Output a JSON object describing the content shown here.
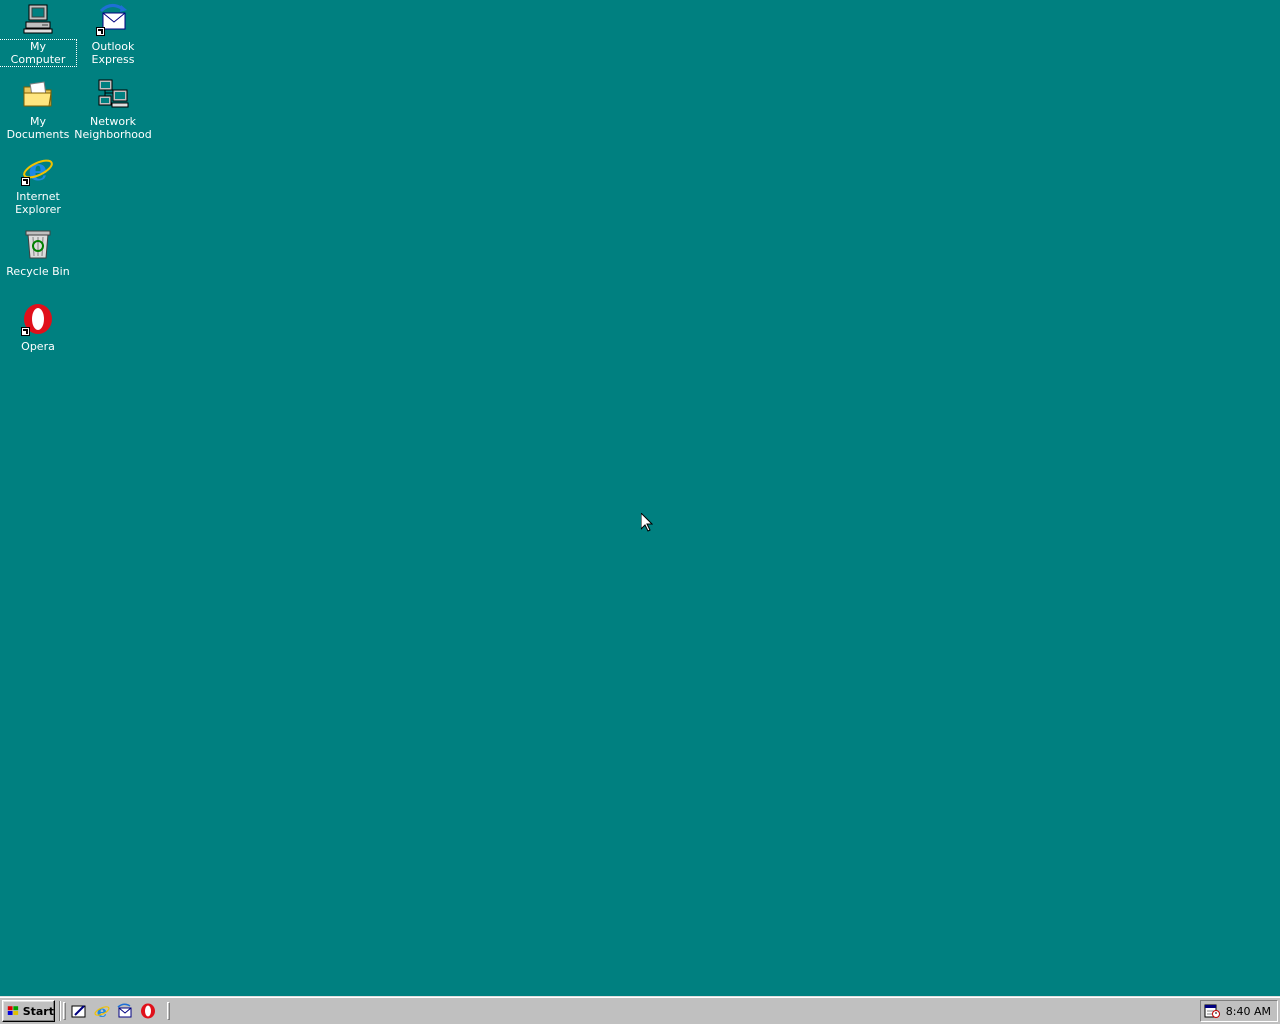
{
  "desktop": {
    "background_color": "#008080",
    "icons": [
      {
        "label": "My Computer",
        "icon": "my-computer-icon",
        "selected": true
      },
      {
        "label": "Outlook\nExpress",
        "icon": "outlook-express-icon",
        "shortcut": true
      },
      {
        "label": "My Documents",
        "icon": "my-documents-icon"
      },
      {
        "label": "Network\nNeighborhood",
        "icon": "network-neighborhood-icon"
      },
      {
        "label": "Internet\nExplorer",
        "icon": "internet-explorer-icon",
        "shortcut": true
      },
      {
        "label": "Recycle Bin",
        "icon": "recycle-bin-icon"
      },
      {
        "label": "Opera",
        "icon": "opera-icon",
        "shortcut": true
      }
    ]
  },
  "taskbar": {
    "start_label": "Start",
    "quick_launch": [
      {
        "icon": "show-desktop-icon"
      },
      {
        "icon": "internet-explorer-icon"
      },
      {
        "icon": "outlook-express-icon"
      },
      {
        "icon": "opera-icon"
      }
    ],
    "tray": {
      "icon": "scheduled-tasks-icon",
      "clock": "8:40 AM"
    }
  }
}
